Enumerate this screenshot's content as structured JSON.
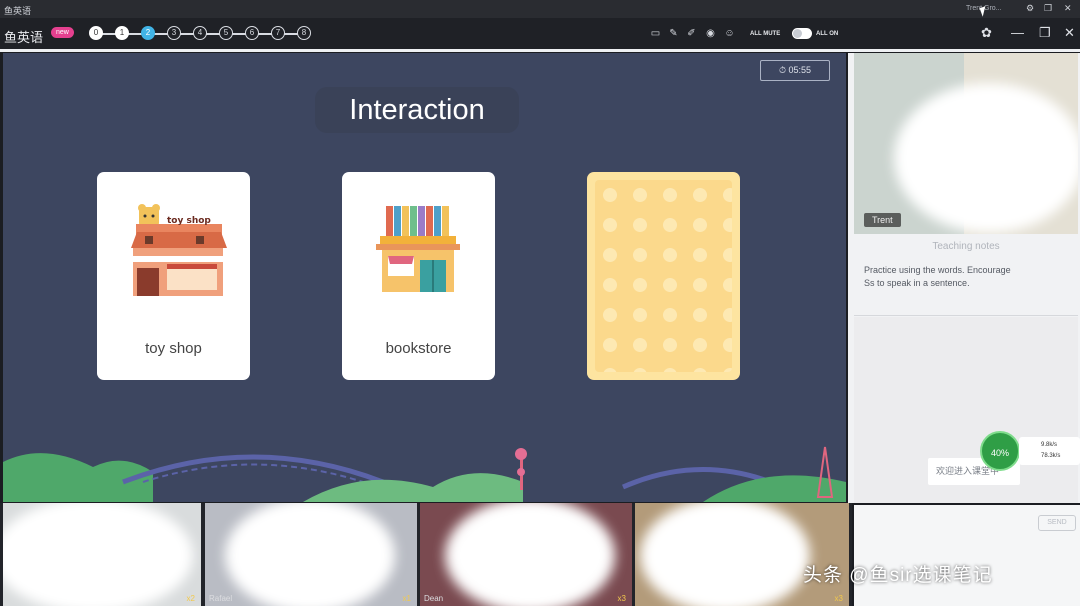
{
  "window": {
    "title_fragment": "鱼英语",
    "user_label": "Trent Gro...",
    "titlebar_icons": [
      "gear-icon",
      "restore-icon",
      "close-icon"
    ]
  },
  "toolbar": {
    "brand": "鱼英语",
    "badge": "new",
    "steps": [
      "0",
      "1",
      "2",
      "3",
      "4",
      "5",
      "6",
      "7",
      "8"
    ],
    "current_step": 2,
    "tool_icons": [
      "screen-icon",
      "pen-icon",
      "highlighter-icon",
      "camera-icon",
      "emoji-icon"
    ],
    "all_mute_label": "ALL MUTE",
    "all_on_label": "ALL ON",
    "window_icons": [
      "settings-icon",
      "minimize-icon",
      "maximize-icon",
      "close-icon"
    ]
  },
  "stage": {
    "timer": "05:55",
    "title": "Interaction",
    "cards": [
      {
        "label": "toy shop",
        "sign": "toy shop",
        "icon": "toy-shop-illustration"
      },
      {
        "label": "bookstore",
        "icon": "bookstore-illustration"
      },
      {
        "label": "",
        "icon": "card-back-pattern",
        "face_down": true
      }
    ],
    "colors": {
      "background": "#3d4660",
      "card": "#ffffff",
      "card_back": "#fde4a0",
      "hills": "#4fa86a",
      "bridge": "#5b63a8",
      "tower": "#e0667f"
    }
  },
  "sidebar": {
    "video_label": "Trent",
    "notes_title": "Teaching notes",
    "notes_text": "Practice using the words. Encourage Ss to speak in a sentence.",
    "chat_placeholder": "欢迎进入课堂中",
    "network": {
      "percent": "40%",
      "up": "9.8k/s",
      "down": "78.3k/s"
    },
    "send_label": "SEND"
  },
  "students": [
    {
      "name": "",
      "stars": "x2"
    },
    {
      "name": "Rafael",
      "stars": "x1"
    },
    {
      "name": "Dean",
      "stars": "x3"
    },
    {
      "name": "",
      "stars": "x3"
    }
  ],
  "watermark": "头条 @鱼sir选课笔记"
}
